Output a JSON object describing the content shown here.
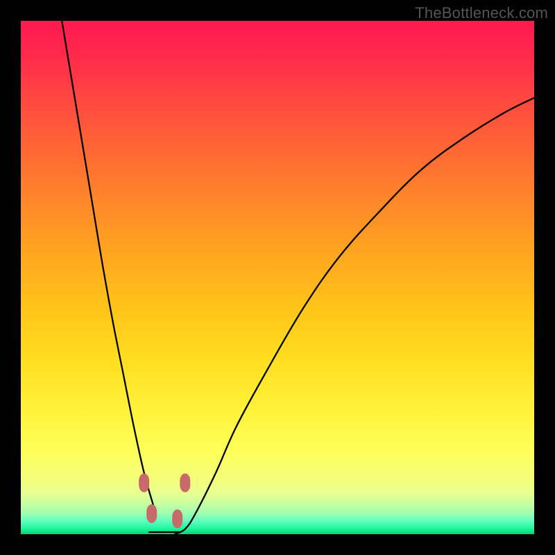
{
  "attribution": "TheBottleneck.com",
  "colors": {
    "frame_bg": "#000000",
    "curve_stroke": "#000000",
    "marker_fill": "#c96a6a",
    "gradient_top": "#ff1a4f",
    "gradient_bottom": "#00d472"
  },
  "chart_data": {
    "type": "line",
    "title": "",
    "xlabel": "",
    "ylabel": "",
    "xlim": [
      0,
      100
    ],
    "ylim": [
      0,
      100
    ],
    "description": "Absolute-deviation style V curve: y rises steeply away from a flat minimum basin near x≈25–31, on a red→green vertical gradient background.",
    "series": [
      {
        "name": "curve",
        "x": [
          8,
          10,
          12,
          14,
          16,
          18,
          20,
          22,
          24,
          26,
          28,
          30,
          32,
          34,
          38,
          42,
          48,
          55,
          62,
          70,
          78,
          86,
          94,
          100
        ],
        "y": [
          100,
          88,
          76,
          64,
          52,
          41,
          31,
          21,
          12,
          5,
          1,
          0,
          1,
          4,
          12,
          21,
          32,
          44,
          54,
          63,
          71,
          77,
          82,
          85
        ]
      }
    ],
    "flat_minimum": {
      "x_start": 25,
      "x_end": 31,
      "y": 0
    },
    "markers": [
      {
        "x": 24.0,
        "y": 10,
        "label": "left-upper"
      },
      {
        "x": 25.5,
        "y": 4,
        "label": "left-lower"
      },
      {
        "x": 30.5,
        "y": 3,
        "label": "right-lower"
      },
      {
        "x": 32.0,
        "y": 10,
        "label": "right-upper"
      }
    ]
  }
}
